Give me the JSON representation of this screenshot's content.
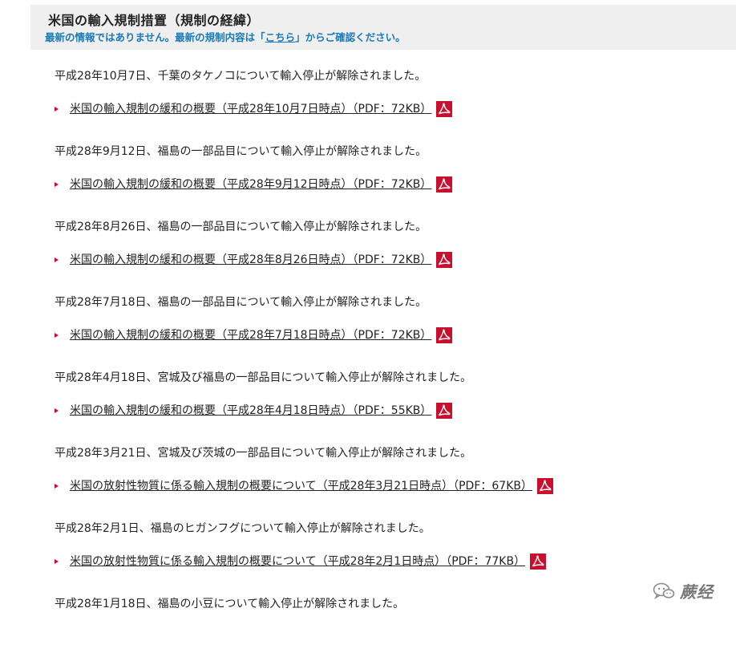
{
  "header": {
    "title": "米国の輸入規制措置（規制の経緯）",
    "notice_prefix": "最新の情報ではありません。最新の規制内容は「",
    "notice_link": "こちら",
    "notice_suffix": "」からご確認ください。"
  },
  "entries": [
    {
      "text": "平成28年10月7日、千葉のタケノコについて輸入停止が解除されました。",
      "link": "米国の輸入規制の緩和の概要（平成28年10月7日時点）（PDF：72KB）"
    },
    {
      "text": "平成28年9月12日、福島の一部品目について輸入停止が解除されました。",
      "link": "米国の輸入規制の緩和の概要（平成28年9月12日時点）（PDF：72KB）"
    },
    {
      "text": "平成28年8月26日、福島の一部品目について輸入停止が解除されました。",
      "link": "米国の輸入規制の緩和の概要（平成28年8月26日時点）（PDF：72KB）"
    },
    {
      "text": "平成28年7月18日、福島の一部品目について輸入停止が解除されました。",
      "link": "米国の輸入規制の緩和の概要（平成28年7月18日時点）（PDF：72KB）"
    },
    {
      "text": "平成28年4月18日、宮城及び福島の一部品目について輸入停止が解除されました。",
      "link": "米国の輸入規制の緩和の概要（平成28年4月18日時点）（PDF：55KB）"
    },
    {
      "text": "平成28年3月21日、宮城及び茨城の一部品目について輸入停止が解除されました。",
      "link": "米国の放射性物質に係る輸入規制の概要について（平成28年3月21日時点）（PDF：67KB）"
    },
    {
      "text": "平成28年2月1日、福島のヒガンフグについて輸入停止が解除されました。",
      "link": "米国の放射性物質に係る輸入規制の概要について（平成28年2月1日時点）（PDF：77KB）"
    },
    {
      "text": "平成28年1月18日、福島の小豆について輸入停止が解除されました。",
      "link": ""
    }
  ],
  "watermark": {
    "text": "蕨经",
    "icon": "wechat-icon"
  },
  "colors": {
    "header_bg": "#efefef",
    "notice": "#1a7ab8",
    "chevron": "#c8102e",
    "pdf_icon": "#c8102e"
  }
}
